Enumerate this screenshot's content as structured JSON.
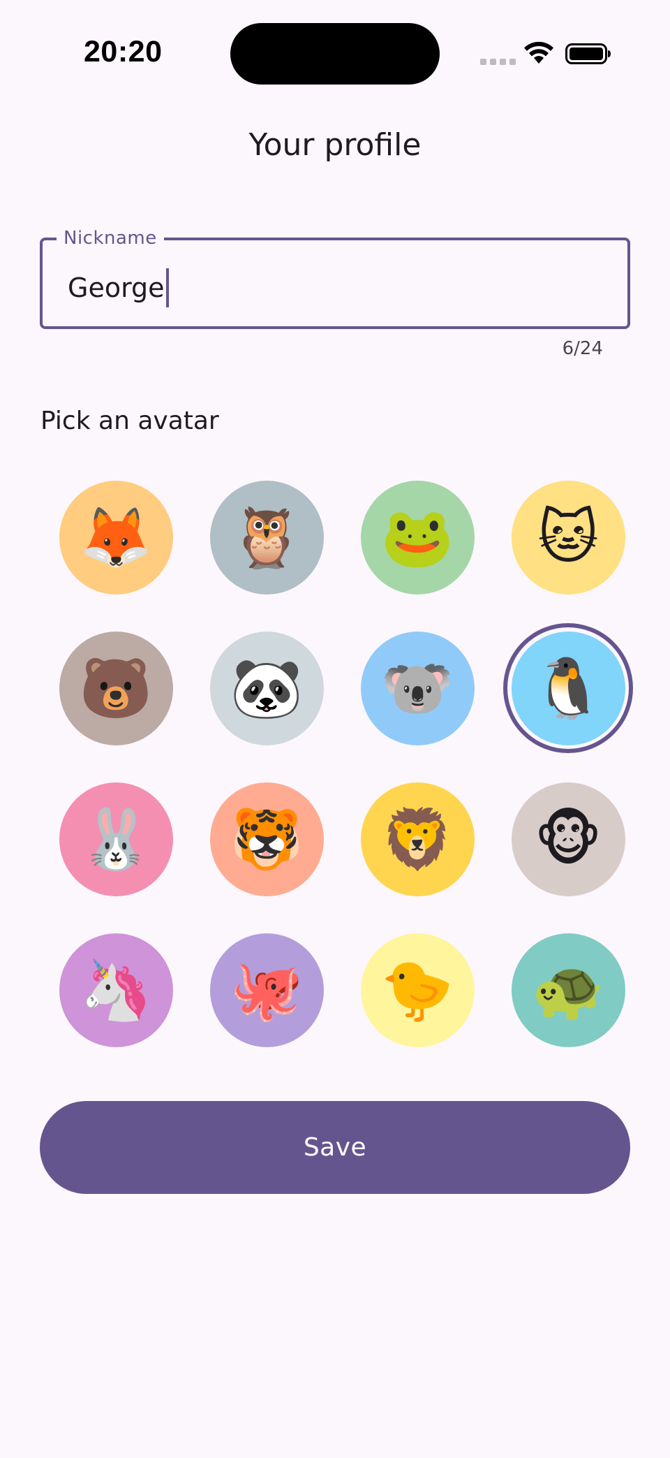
{
  "status_bar": {
    "time": "20:20",
    "icons": [
      "signal-dots-icon",
      "wifi-icon",
      "battery-icon"
    ]
  },
  "header": {
    "title": "Your profile"
  },
  "nickname": {
    "label": "Nickname",
    "value": "George",
    "counter": "6/24"
  },
  "avatar_section": {
    "label": "Pick an avatar",
    "selected": "penguin",
    "avatars": [
      {
        "id": "fox",
        "emoji": "🦊",
        "bg": "#ffcc80"
      },
      {
        "id": "owl",
        "emoji": "🦉",
        "bg": "#b0bec5"
      },
      {
        "id": "frog",
        "emoji": "🐸",
        "bg": "#a5d6a7"
      },
      {
        "id": "cat",
        "emoji": "🐱",
        "bg": "#ffe082"
      },
      {
        "id": "bear",
        "emoji": "🐻",
        "bg": "#bcaaa4"
      },
      {
        "id": "panda",
        "emoji": "🐼",
        "bg": "#cfd8dc"
      },
      {
        "id": "koala",
        "emoji": "🐨",
        "bg": "#90caf9"
      },
      {
        "id": "penguin",
        "emoji": "🐧",
        "bg": "#81d4fa"
      },
      {
        "id": "rabbit",
        "emoji": "🐰",
        "bg": "#f48fb1"
      },
      {
        "id": "tiger",
        "emoji": "🐯",
        "bg": "#ffab91"
      },
      {
        "id": "lion",
        "emoji": "🦁",
        "bg": "#ffd54f"
      },
      {
        "id": "monkey",
        "emoji": "🐵",
        "bg": "#d7ccc8"
      },
      {
        "id": "unicorn",
        "emoji": "🦄",
        "bg": "#ce93d8"
      },
      {
        "id": "octopus",
        "emoji": "🐙",
        "bg": "#b39ddb"
      },
      {
        "id": "chick",
        "emoji": "🐤",
        "bg": "#fff59d"
      },
      {
        "id": "turtle",
        "emoji": "🐢",
        "bg": "#80cbc4"
      }
    ]
  },
  "actions": {
    "save_label": "Save"
  },
  "colors": {
    "primary": "#65558f",
    "background": "#fcf7fc",
    "on_surface": "#1d1b20"
  }
}
